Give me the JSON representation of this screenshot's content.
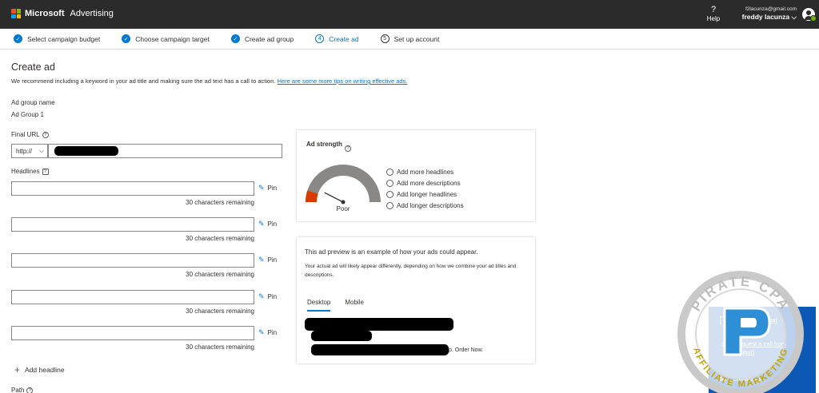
{
  "header": {
    "brand": "Microsoft",
    "product": "Advertising",
    "help_label": "Help",
    "help_glyph": "?",
    "email": "f2lacunza@gmail.com",
    "user_name": "freddy lacunza",
    "logo_colors": [
      "#f25022",
      "#7fba00",
      "#00a4ef",
      "#ffb900"
    ]
  },
  "steps": [
    {
      "label": "Select campaign budget",
      "state": "done",
      "mark": "✓"
    },
    {
      "label": "Choose campaign target",
      "state": "done",
      "mark": "✓"
    },
    {
      "label": "Create ad group",
      "state": "done",
      "mark": "✓"
    },
    {
      "label": "Create ad",
      "state": "active",
      "mark": "4"
    },
    {
      "label": "Set up account",
      "state": "todo",
      "mark": "5"
    }
  ],
  "page": {
    "title": "Create ad",
    "intro": "We recommend including a keyword in your ad title and making sure the ad text has a call to action.",
    "intro_link": "Here are some more tips on writing effective ads."
  },
  "ad_group": {
    "label": "Ad group name",
    "value": "Ad Group 1"
  },
  "final_url": {
    "label": "Final URL",
    "protocol": "http://",
    "value": ""
  },
  "headlines": {
    "label": "Headlines",
    "pin_label": "Pin",
    "items": [
      {
        "value": "",
        "remaining": "30 characters remaining"
      },
      {
        "value": "",
        "remaining": "30 characters remaining"
      },
      {
        "value": "",
        "remaining": "30 characters remaining"
      },
      {
        "value": "",
        "remaining": "30 characters remaining"
      },
      {
        "value": "",
        "remaining": "30 characters remaining"
      }
    ],
    "add_label": "Add headline"
  },
  "path_label": "Path",
  "ad_strength": {
    "title": "Ad strength",
    "rating": "Poor",
    "level": 0.1,
    "level_color": "#d83b01",
    "suggestions": [
      "Add more headlines",
      "Add more descriptions",
      "Add longer headlines",
      "Add longer descriptions"
    ]
  },
  "preview": {
    "heading": "This ad preview is an example of how your ads could appear.",
    "note": "Your actual ad will likely appear differently, depending on how we combine your ad titles and descriptions.",
    "tabs": [
      "Desktop",
      "Mobile"
    ],
    "active_tab": "Desktop",
    "order_text": "p. Order Now."
  },
  "support": {
    "chat": "Start a live chat",
    "call": "Request a call from support",
    "contact": "Contact us"
  },
  "watermark": {
    "text_top": "PIRATE CPA",
    "text_bottom": "AFFILIATE MARKETING"
  }
}
